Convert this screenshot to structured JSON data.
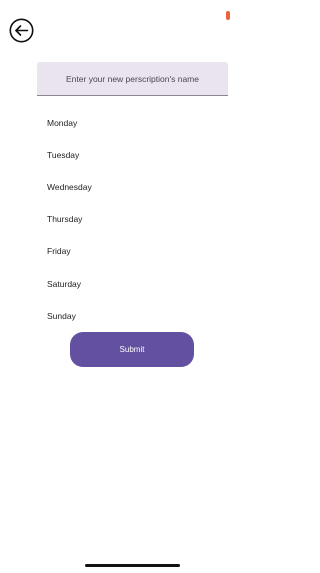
{
  "header": {
    "back_icon": "arrow-left-circle-icon"
  },
  "form": {
    "name_placeholder": "Enter your new perscription's name",
    "name_value": ""
  },
  "days": [
    {
      "label": "Monday"
    },
    {
      "label": "Tuesday"
    },
    {
      "label": "Wednesday"
    },
    {
      "label": "Thursday"
    },
    {
      "label": "Friday"
    },
    {
      "label": "Saturday"
    },
    {
      "label": "Sunday"
    }
  ],
  "submit": {
    "label": "Submit"
  },
  "colors": {
    "accent": "#6450a0",
    "input_background": "#e9e4ee",
    "status_indicator": "#e8643a"
  }
}
